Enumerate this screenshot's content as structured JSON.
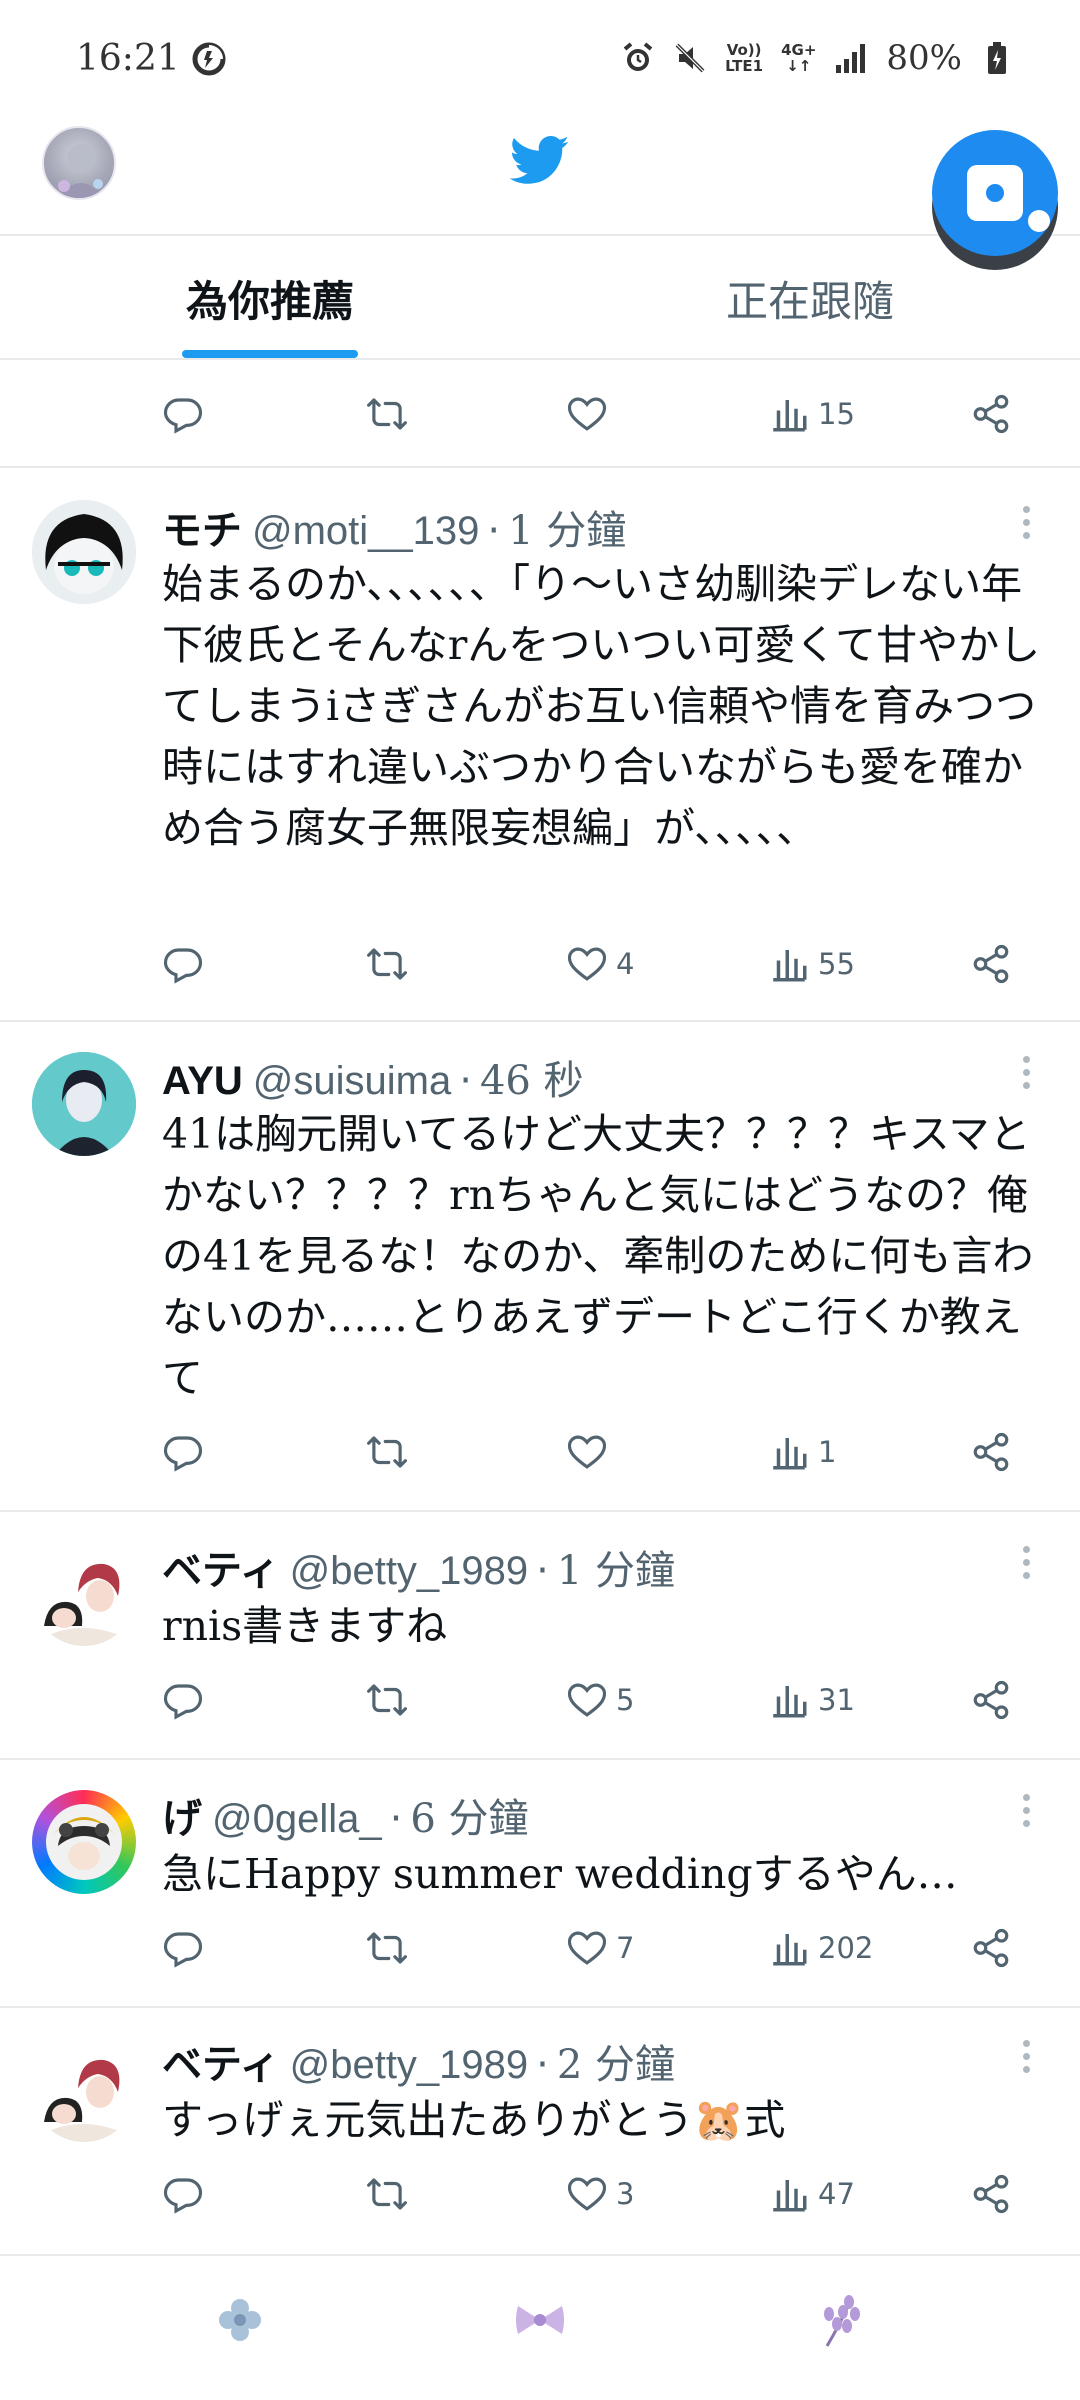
{
  "status_bar": {
    "time": "16:21",
    "network_top": "Vo))",
    "network_bottom": "LTE1",
    "mobile_top": "4G+",
    "battery": "80%",
    "icons": [
      "data-saver-icon",
      "alarm-icon",
      "mute-icon",
      "signal-icon",
      "battery-icon"
    ]
  },
  "header": {
    "logo": "twitter-bird-icon",
    "brand_color": "#1d9bf0"
  },
  "tabs": [
    {
      "label": "為你推薦",
      "active": true
    },
    {
      "label": "正在跟隨",
      "active": false
    }
  ],
  "partial_tweet": {
    "views": "15"
  },
  "tweets": [
    {
      "name": "モチ",
      "handle": "@moti__139",
      "time": "1 分鐘",
      "text": "始まるのか、、、、、、「り〜いさ幼馴染デレない年下彼氏とそんなrんをついつい可愛くて甘やかしてしまうiさぎさんがお互い信頼や情を育みつつ時にはすれ違いぶつかり合いながらも愛を確かめ合う腐女子無限妄想編」が、、、、、",
      "likes": "4",
      "views": "55"
    },
    {
      "name": "AYU",
      "handle": "@suisuima",
      "time": "46 秒",
      "text": "41は胸元開いてるけど大丈夫？？？？キスマとかない？？？？rnちゃんと気にはどうなの？俺の41を見るな！なのか、牽制のために何も言わないのか……とりあえずデートどこ行くか教えて",
      "likes": "",
      "views": "1"
    },
    {
      "name": "ベティ",
      "handle": "@betty_1989",
      "time": "1 分鐘",
      "text": "rnis書きますね",
      "likes": "5",
      "views": "31"
    },
    {
      "name": "げ",
      "handle": "@0gella_",
      "time": "6 分鐘",
      "text": "急にHappy summer weddingするやん…",
      "likes": "7",
      "views": "202"
    },
    {
      "name": "ベティ",
      "handle": "@betty_1989",
      "time": "2 分鐘",
      "text": "すっげぇ元気出たありがとう🐹式",
      "likes": "3",
      "views": "47"
    }
  ],
  "bottom_nav": [
    "home-flower-icon",
    "search-ribbon-icon",
    "notifications-lavender-icon"
  ]
}
